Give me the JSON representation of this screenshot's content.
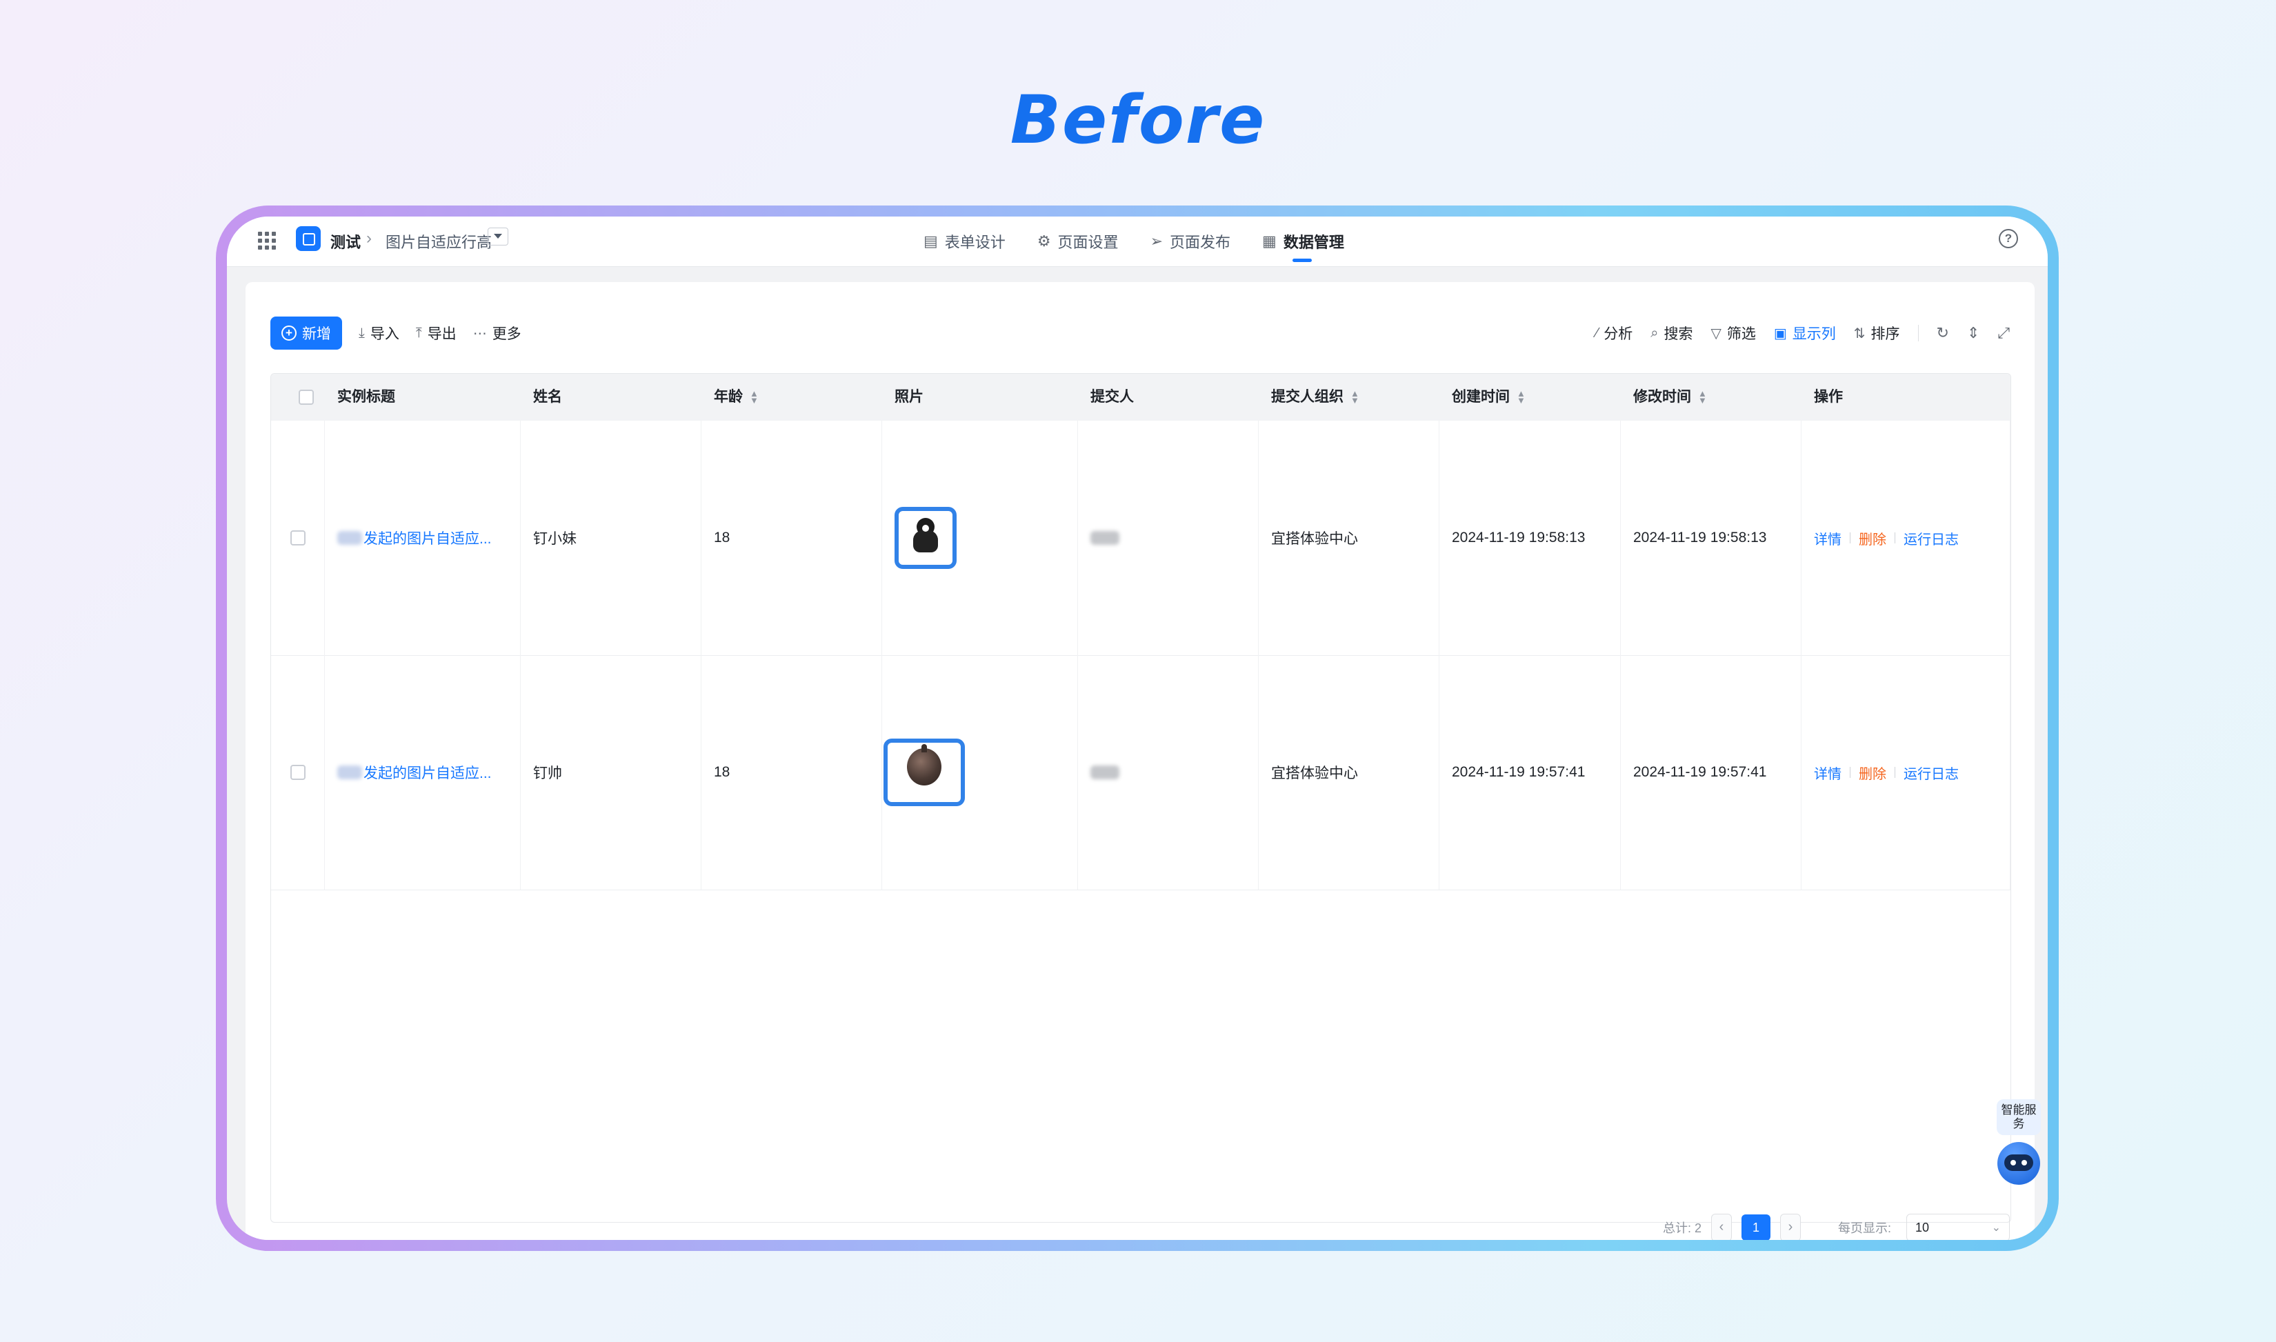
{
  "heading": "Before",
  "breadcrumb": {
    "app": "测试",
    "page": "图片自适应行高"
  },
  "nav_tabs": [
    {
      "label": "表单设计",
      "icon": "file-icon"
    },
    {
      "label": "页面设置",
      "icon": "gear-icon"
    },
    {
      "label": "页面发布",
      "icon": "send-icon"
    },
    {
      "label": "数据管理",
      "icon": "table-icon",
      "active": true
    }
  ],
  "toolbar": {
    "add": "新增",
    "import": "导入",
    "export": "导出",
    "more": "更多",
    "analyze": "分析",
    "search": "搜索",
    "filter": "筛选",
    "columns": "显示列",
    "sort": "排序"
  },
  "table": {
    "headers": [
      "实例标题",
      "姓名",
      "年龄",
      "照片",
      "提交人",
      "提交人组织",
      "创建时间",
      "修改时间",
      "操作"
    ],
    "rows": [
      {
        "title": "发起的图片自适应...",
        "name": "钉小妹",
        "age": "18",
        "photo": "ghost-avatar",
        "org": "宜搭体验中心",
        "created": "2024-11-19 19:58:13",
        "modified": "2024-11-19 19:58:13"
      },
      {
        "title": "发起的图片自适应...",
        "name": "钉帅",
        "age": "18",
        "photo": "orb-avatar",
        "org": "宜搭体验中心",
        "created": "2024-11-19 19:57:41",
        "modified": "2024-11-19 19:57:41"
      }
    ],
    "actions": {
      "detail": "详情",
      "delete": "删除",
      "log": "运行日志"
    }
  },
  "pagination": {
    "total": "总计: 2",
    "current": "1",
    "per_page_label": "每页显示:",
    "per_page": "10"
  },
  "assistant": {
    "label": "智能服务"
  },
  "colors": {
    "primary": "#1677ff",
    "danger": "#f5651e",
    "heading": "#1570ef"
  }
}
